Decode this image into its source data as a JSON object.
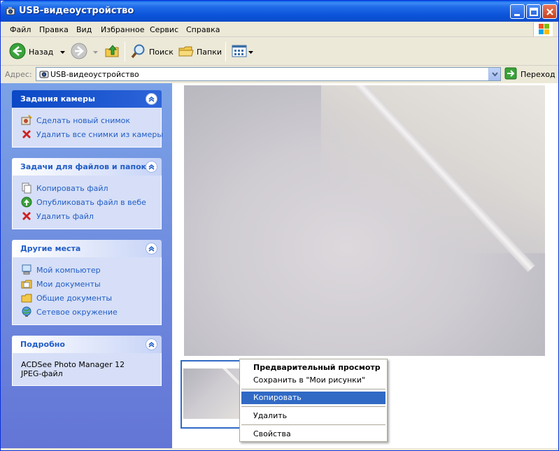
{
  "window": {
    "title": "USB-видеоустройство"
  },
  "menu": [
    "Файл",
    "Правка",
    "Вид",
    "Избранное",
    "Сервис",
    "Справка"
  ],
  "toolbar": {
    "back_label": "Назад",
    "search_label": "Поиск",
    "folders_label": "Папки"
  },
  "address": {
    "label": "Адрес:",
    "value": "USB-видеоустройство",
    "go_label": "Переход"
  },
  "taskpane": {
    "camera": {
      "title": "Задания камеры",
      "items": [
        "Сделать новый снимок",
        "Удалить все снимки из камеры"
      ]
    },
    "files": {
      "title": "Задачи для файлов и папок",
      "items": [
        "Копировать файл",
        "Опубликовать файл в вебе",
        "Удалить файл"
      ]
    },
    "places": {
      "title": "Другие места",
      "items": [
        "Мой компьютер",
        "Мои документы",
        "Общие документы",
        "Сетевое окружение"
      ]
    },
    "details": {
      "title": "Подробно",
      "lines": [
        "ACDSee Photo Manager 12",
        "JPEG-файл"
      ]
    }
  },
  "context_menu": {
    "items": [
      "Предварительный просмотр",
      "Сохранить в \"Мои рисунки\"",
      "Копировать",
      "Удалить",
      "Свойства"
    ]
  },
  "colors": {
    "accent": "#316ac5",
    "link": "#215dc6",
    "title_bar": "#0b53d9"
  }
}
